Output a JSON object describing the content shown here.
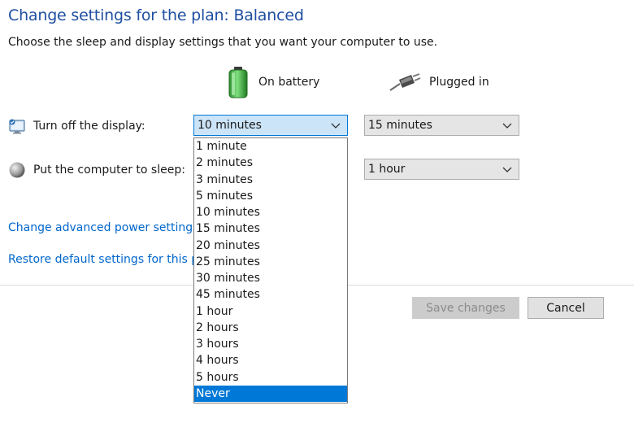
{
  "header": {
    "title": "Change settings for the plan: Balanced",
    "subtitle": "Choose the sleep and display settings that you want your computer to use."
  },
  "columns": {
    "battery": {
      "label": "On battery",
      "icon": "battery-icon"
    },
    "plugged": {
      "label": "Plugged in",
      "icon": "power-plug-icon"
    }
  },
  "rows": {
    "display": {
      "label": "Turn off the display:",
      "icon": "display-icon",
      "battery_value": "10 minutes",
      "plugged_value": "15 minutes"
    },
    "sleep": {
      "label": "Put the computer to sleep:",
      "icon": "sleep-moon-icon",
      "plugged_value": "1 hour"
    }
  },
  "links": {
    "advanced": "Change advanced power settings",
    "restore": "Restore default settings for this pl"
  },
  "dropdown": {
    "highlighted": "Never",
    "options": [
      "1 minute",
      "2 minutes",
      "3 minutes",
      "5 minutes",
      "10 minutes",
      "15 minutes",
      "20 minutes",
      "25 minutes",
      "30 minutes",
      "45 minutes",
      "1 hour",
      "2 hours",
      "3 hours",
      "4 hours",
      "5 hours",
      "Never"
    ]
  },
  "buttons": {
    "save": "Save changes",
    "cancel": "Cancel"
  },
  "colors": {
    "title": "#1f4fa1",
    "link": "#0066cc",
    "accent": "#0078d7",
    "active_select_bg": "#cce4f7"
  }
}
